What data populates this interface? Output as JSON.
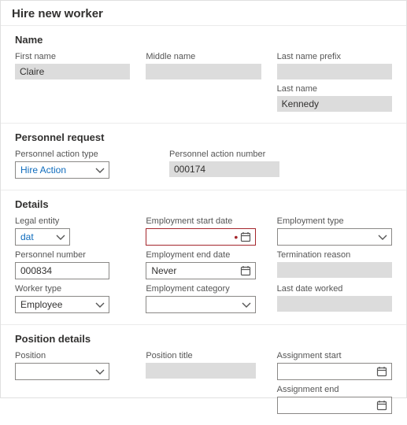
{
  "page_title": "Hire new worker",
  "name": {
    "section_title": "Name",
    "first_name_label": "First name",
    "first_name_value": "Claire",
    "middle_name_label": "Middle name",
    "middle_name_value": "",
    "last_name_prefix_label": "Last name prefix",
    "last_name_prefix_value": "",
    "last_name_label": "Last name",
    "last_name_value": "Kennedy"
  },
  "personnel": {
    "section_title": "Personnel request",
    "action_type_label": "Personnel action type",
    "action_type_value": "Hire Action",
    "action_number_label": "Personnel action number",
    "action_number_value": "000174"
  },
  "details": {
    "section_title": "Details",
    "legal_entity_label": "Legal entity",
    "legal_entity_value": "dat",
    "personnel_number_label": "Personnel number",
    "personnel_number_value": "000834",
    "worker_type_label": "Worker type",
    "worker_type_value": "Employee",
    "emp_start_label": "Employment start date",
    "emp_start_value": "",
    "emp_end_label": "Employment end date",
    "emp_end_value": "Never",
    "emp_cat_label": "Employment category",
    "emp_cat_value": "",
    "emp_type_label": "Employment type",
    "emp_type_value": "",
    "term_reason_label": "Termination reason",
    "term_reason_value": "",
    "last_worked_label": "Last date worked",
    "last_worked_value": ""
  },
  "position": {
    "section_title": "Position details",
    "position_label": "Position",
    "position_value": "",
    "position_title_label": "Position title",
    "position_title_value": "",
    "assign_start_label": "Assignment start",
    "assign_start_value": "",
    "assign_end_label": "Assignment end",
    "assign_end_value": ""
  }
}
